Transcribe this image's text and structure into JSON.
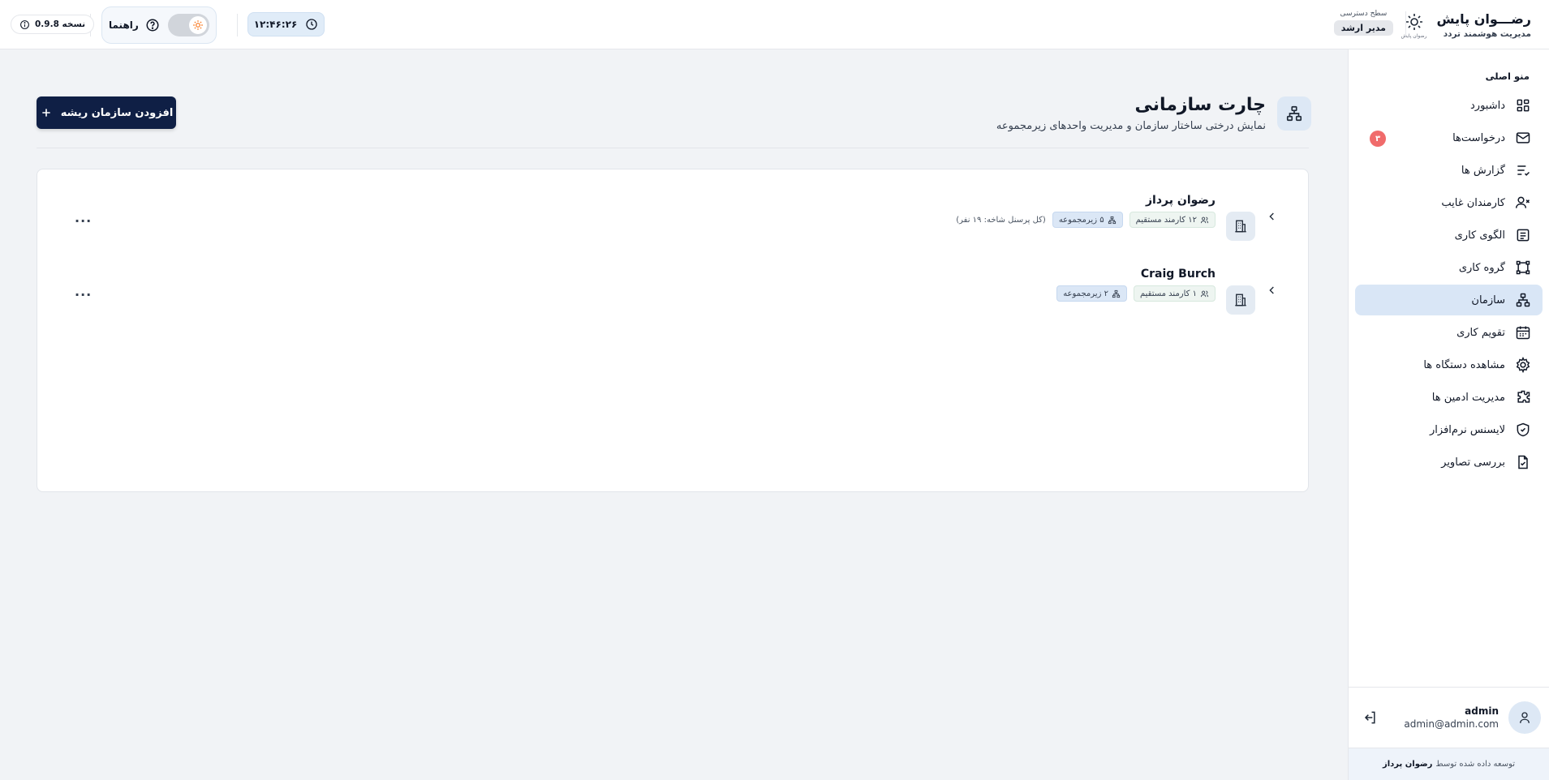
{
  "header": {
    "brand_name": "رضـــوان پایش",
    "brand_sub": "مدیریت هوشمند تردد",
    "logo_sub": "رضوان پایش",
    "access_label": "سطح دسترسی",
    "access_role": "مدیر ارشد",
    "clock": "۱۲:۴۶:۲۶",
    "help_label": "راهنما",
    "version": "نسخه 0.9.8"
  },
  "sidebar": {
    "title": "منو اصلی",
    "items": [
      {
        "label": "داشبورد",
        "icon": "dashboard-icon"
      },
      {
        "label": "درخواست‌ها",
        "icon": "mail-icon",
        "badge": "۳"
      },
      {
        "label": "گزارش ها",
        "icon": "report-list-icon"
      },
      {
        "label": "کارمندان غایب",
        "icon": "user-x-icon"
      },
      {
        "label": "الگوی کاری",
        "icon": "pattern-icon"
      },
      {
        "label": "گروه کاری",
        "icon": "group-icon"
      },
      {
        "label": "سازمان",
        "icon": "org-icon",
        "active": true
      },
      {
        "label": "تقویم کاری",
        "icon": "calendar-icon"
      },
      {
        "label": "مشاهده دستگاه ها",
        "icon": "gear-icon"
      },
      {
        "label": "مدیریت ادمین ها",
        "icon": "puzzle-icon"
      },
      {
        "label": "لایسنس نرم‌افزار",
        "icon": "shield-icon"
      },
      {
        "label": "بررسی تصاویر",
        "icon": "file-check-icon"
      }
    ],
    "user": {
      "name": "admin",
      "email": "admin@admin.com"
    },
    "credit_prefix": "توسعه داده شده توسط",
    "credit_name": "رضوان پرداز"
  },
  "main": {
    "title": "چارت سازمانی",
    "subtitle": "نمایش درختی ساختار سازمان و مدیریت واحدهای زیرمجموعه",
    "add_root_label": "افزودن سازمان ریشه",
    "nodes": [
      {
        "name": "رضوان پرداز",
        "staff": "۱۲ کارمند مستقیم",
        "sub": "۵ زیرمجموعه",
        "total": "(کل پرسنل شاخه: ۱۹ نفر)"
      },
      {
        "name": "Craig Burch",
        "staff": "۱ کارمند مستقیم",
        "sub": "۲ زیرمجموعه",
        "total": ""
      }
    ],
    "more_label": "..."
  },
  "colors": {
    "primary_button": "#0f1f45",
    "active_menu": "#d9e6f6",
    "badge": "#f06b6b",
    "background": "#f1f3f6"
  }
}
